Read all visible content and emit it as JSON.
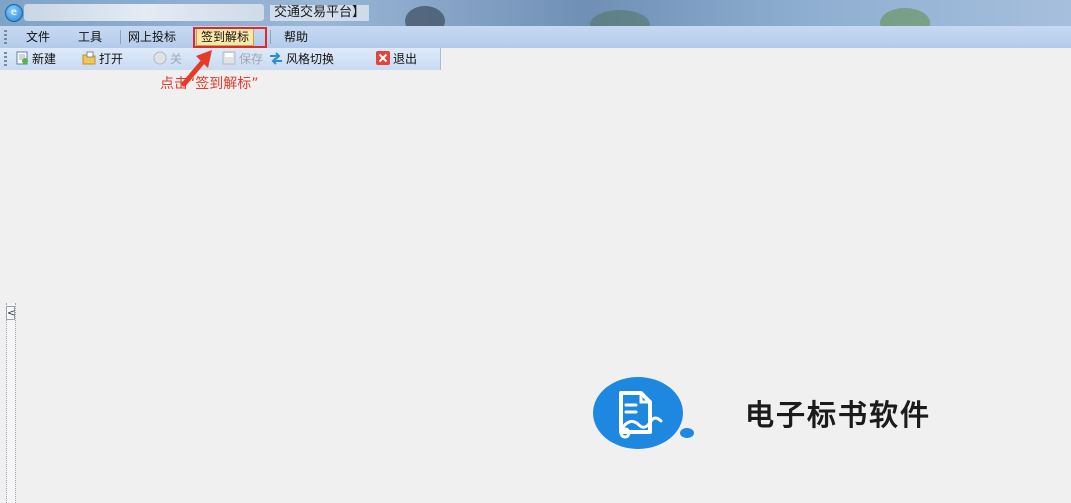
{
  "window": {
    "title": "交通交易平台】"
  },
  "menubar": {
    "items": [
      {
        "label": "文件"
      },
      {
        "label": "工具"
      },
      {
        "label": "网上投标"
      },
      {
        "label": "签到解标"
      },
      {
        "label": "帮助"
      }
    ]
  },
  "toolbar": {
    "new_label": "新建",
    "open_label": "打开",
    "close_label": "关",
    "save_label": "保存",
    "style_label": "风格切换",
    "exit_label": "退出"
  },
  "annotation": {
    "text": "点击“签到解标”",
    "color": "#e53a2a"
  },
  "sidebar": {
    "collapse_glyph": "<"
  },
  "logo": {
    "text": "电子标书软件",
    "color": "#1e88e0"
  },
  "icons": [
    "app-logo-icon",
    "new-doc-icon",
    "open-folder-icon",
    "close-icon",
    "save-icon",
    "swap-arrows-icon",
    "exit-x-icon",
    "document-logo-icon"
  ]
}
